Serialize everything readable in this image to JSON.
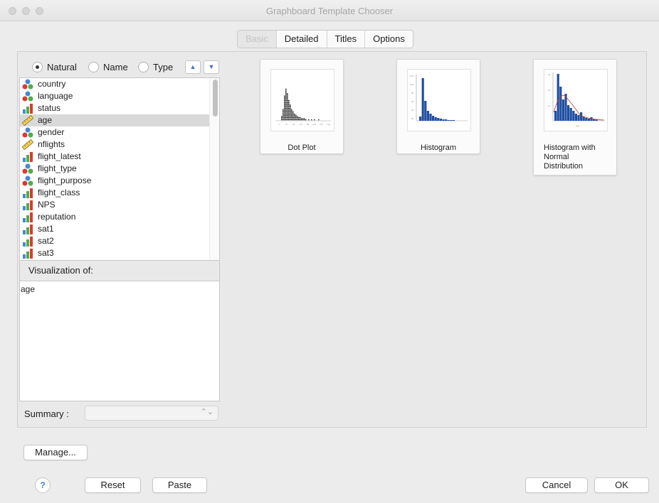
{
  "window": {
    "title": "Graphboard Template Chooser"
  },
  "tabs": [
    {
      "label": "Basic",
      "selected": true
    },
    {
      "label": "Detailed",
      "selected": false
    },
    {
      "label": "Titles",
      "selected": false
    },
    {
      "label": "Options",
      "selected": false
    }
  ],
  "sort": {
    "options": [
      "Natural",
      "Name",
      "Type"
    ],
    "selected": "Natural",
    "up_icon": "triangle-up-icon",
    "down_icon": "triangle-down-icon"
  },
  "variables": [
    {
      "name": "country",
      "type": "nominal"
    },
    {
      "name": "language",
      "type": "nominal"
    },
    {
      "name": "status",
      "type": "ordinal"
    },
    {
      "name": "age",
      "type": "scale",
      "selected": true
    },
    {
      "name": "gender",
      "type": "nominal"
    },
    {
      "name": "nflights",
      "type": "scale"
    },
    {
      "name": "flight_latest",
      "type": "ordinal"
    },
    {
      "name": "flight_type",
      "type": "nominal"
    },
    {
      "name": "flight_purpose",
      "type": "nominal"
    },
    {
      "name": "flight_class",
      "type": "ordinal"
    },
    {
      "name": "NPS",
      "type": "ordinal"
    },
    {
      "name": "reputation",
      "type": "ordinal"
    },
    {
      "name": "sat1",
      "type": "ordinal"
    },
    {
      "name": "sat2",
      "type": "ordinal"
    },
    {
      "name": "sat3",
      "type": "ordinal"
    }
  ],
  "visualization": {
    "heading": "Visualization of:",
    "value": "age"
  },
  "summary": {
    "label": "Summary :",
    "value": ""
  },
  "templates": [
    {
      "label": "Dot Plot",
      "thumbnail": "dot-plot-thumbnail"
    },
    {
      "label": "Histogram",
      "thumbnail": "histogram-thumbnail"
    },
    {
      "label": "Histogram with Normal Distribution",
      "thumbnail": "histogram-normal-thumbnail"
    }
  ],
  "buttons": {
    "manage": "Manage...",
    "help": "?",
    "reset": "Reset",
    "paste": "Paste",
    "cancel": "Cancel",
    "ok": "OK"
  },
  "colors": {
    "accent": "#3a7bd5",
    "histogram_bar": "#1f4ea1",
    "dot_plot": "#222222",
    "normal_curve": "#c0392b"
  }
}
